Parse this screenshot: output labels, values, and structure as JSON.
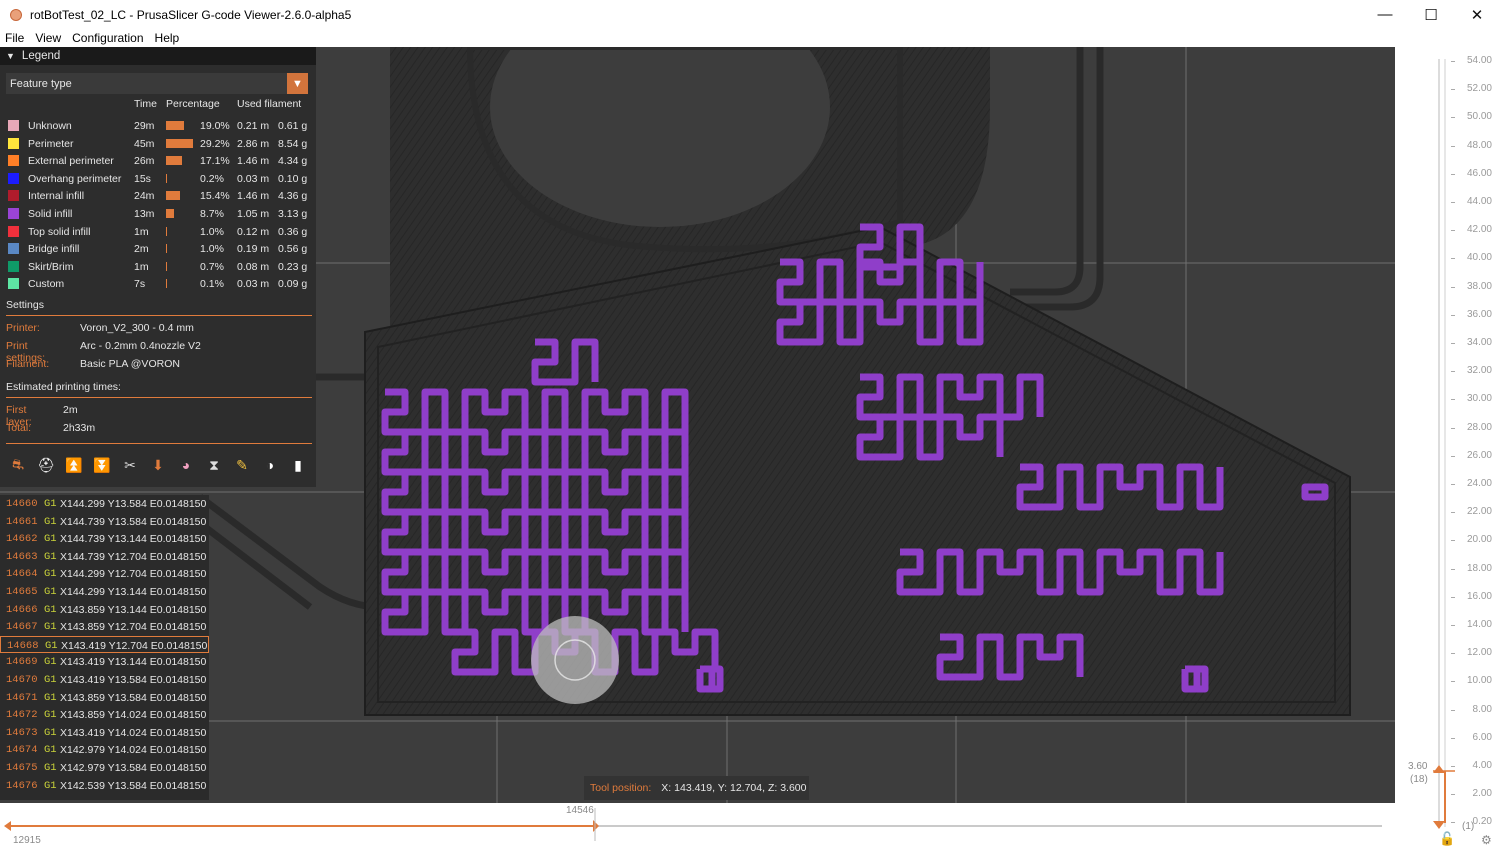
{
  "window": {
    "title": "rotBotTest_02_LC - PrusaSlicer G-code Viewer-2.6.0-alpha5",
    "controls": [
      "—",
      "☐",
      "✕"
    ]
  },
  "menu": [
    "File",
    "View",
    "Configuration",
    "Help"
  ],
  "legend": {
    "title": "Legend",
    "view_type": "Feature type",
    "columns": {
      "time": "Time",
      "percentage": "Percentage",
      "used_filament": "Used filament"
    },
    "items": [
      {
        "name": "Unknown",
        "time": "29m",
        "pct_text": "19.0%",
        "pct": 19.0,
        "length": "0.21 m",
        "weight": "0.61 g",
        "color": "#e8a8b8"
      },
      {
        "name": "Perimeter",
        "time": "45m",
        "pct_text": "29.2%",
        "pct": 29.2,
        "length": "2.86 m",
        "weight": "8.54 g",
        "color": "#ffe63c"
      },
      {
        "name": "External perimeter",
        "time": "26m",
        "pct_text": "17.1%",
        "pct": 17.1,
        "length": "1.46 m",
        "weight": "4.34 g",
        "color": "#ff7f27"
      },
      {
        "name": "Overhang perimeter",
        "time": "15s",
        "pct_text": "0.2%",
        "pct": 0.2,
        "length": "0.03 m",
        "weight": "0.10 g",
        "color": "#1c1cff"
      },
      {
        "name": "Internal infill",
        "time": "24m",
        "pct_text": "15.4%",
        "pct": 15.4,
        "length": "1.46 m",
        "weight": "4.36 g",
        "color": "#b01c2c"
      },
      {
        "name": "Solid infill",
        "time": "13m",
        "pct_text": "8.7%",
        "pct": 8.7,
        "length": "1.05 m",
        "weight": "3.13 g",
        "color": "#9a44d6"
      },
      {
        "name": "Top solid infill",
        "time": "1m",
        "pct_text": "1.0%",
        "pct": 1.0,
        "length": "0.12 m",
        "weight": "0.36 g",
        "color": "#f0303c"
      },
      {
        "name": "Bridge infill",
        "time": "2m",
        "pct_text": "1.0%",
        "pct": 1.0,
        "length": "0.19 m",
        "weight": "0.56 g",
        "color": "#5a88c4"
      },
      {
        "name": "Skirt/Brim",
        "time": "1m",
        "pct_text": "0.7%",
        "pct": 0.7,
        "length": "0.08 m",
        "weight": "0.23 g",
        "color": "#0f9a68"
      },
      {
        "name": "Custom",
        "time": "7s",
        "pct_text": "0.1%",
        "pct": 0.1,
        "length": "0.03 m",
        "weight": "0.09 g",
        "color": "#5ee6a4"
      }
    ],
    "settings": {
      "title": "Settings",
      "printer_label": "Printer:",
      "printer": "Voron_V2_300 - 0.4 mm",
      "print_label": "Print settings:",
      "print": "Arc - 0.2mm 0.4nozzle V2",
      "filament_label": "Filament:",
      "filament": "Basic PLA @VORON"
    },
    "times": {
      "title": "Estimated printing times:",
      "first_layer_label": "First layer:",
      "first_layer": "2m",
      "total_label": "Total:",
      "total": "2h33m"
    },
    "option_icons": [
      "travel-icon",
      "wipe-icon",
      "retraction-icon",
      "deretraction-icon",
      "seam-icon",
      "tool-change-icon",
      "color-change-icon",
      "pause-icon",
      "custom-gcode-icon",
      "center-of-gravity-icon",
      "shells-icon"
    ]
  },
  "gcode": [
    {
      "line": "14660",
      "cmd": "G1",
      "args": "X144.299 Y13.584 E0.0148150"
    },
    {
      "line": "14661",
      "cmd": "G1",
      "args": "X144.739 Y13.584 E0.0148150"
    },
    {
      "line": "14662",
      "cmd": "G1",
      "args": "X144.739 Y13.144 E0.0148150"
    },
    {
      "line": "14663",
      "cmd": "G1",
      "args": "X144.739 Y12.704 E0.0148150"
    },
    {
      "line": "14664",
      "cmd": "G1",
      "args": "X144.299 Y12.704 E0.0148150"
    },
    {
      "line": "14665",
      "cmd": "G1",
      "args": "X144.299 Y13.144 E0.0148150"
    },
    {
      "line": "14666",
      "cmd": "G1",
      "args": "X143.859 Y13.144 E0.0148150"
    },
    {
      "line": "14667",
      "cmd": "G1",
      "args": "X143.859 Y12.704 E0.0148150"
    },
    {
      "line": "14668",
      "cmd": "G1",
      "args": "X143.419 Y12.704 E0.0148150",
      "selected": true
    },
    {
      "line": "14669",
      "cmd": "G1",
      "args": "X143.419 Y13.144 E0.0148150"
    },
    {
      "line": "14670",
      "cmd": "G1",
      "args": "X143.419 Y13.584 E0.0148150"
    },
    {
      "line": "14671",
      "cmd": "G1",
      "args": "X143.859 Y13.584 E0.0148150"
    },
    {
      "line": "14672",
      "cmd": "G1",
      "args": "X143.859 Y14.024 E0.0148150"
    },
    {
      "line": "14673",
      "cmd": "G1",
      "args": "X143.419 Y14.024 E0.0148150"
    },
    {
      "line": "14674",
      "cmd": "G1",
      "args": "X142.979 Y14.024 E0.0148150"
    },
    {
      "line": "14675",
      "cmd": "G1",
      "args": "X142.979 Y13.584 E0.0148150"
    },
    {
      "line": "14676",
      "cmd": "G1",
      "args": "X142.539 Y13.584 E0.0148150"
    }
  ],
  "tool_position": {
    "label": "Tool position:",
    "value": "X: 143.419, Y: 12.704, Z: 3.600"
  },
  "hslider": {
    "current": "14546",
    "start": "12915",
    "position": 0.4
  },
  "vslider": {
    "ticks": [
      "54.00",
      "52.00",
      "50.00",
      "48.00",
      "46.00",
      "44.00",
      "42.00",
      "40.00",
      "38.00",
      "36.00",
      "34.00",
      "32.00",
      "30.00",
      "28.00",
      "26.00",
      "24.00",
      "22.00",
      "20.00",
      "18.00",
      "16.00",
      "14.00",
      "12.00",
      "10.00",
      "8.00",
      "6.00",
      "4.00",
      "2.00",
      "0.20"
    ],
    "current": "3.60",
    "current_layer": "(18)",
    "bottom_layer": "(1)"
  },
  "colors": {
    "accent": "#e07b3c",
    "infill": "#8f3ec9",
    "bed": "#3d3d3d",
    "model": "#2c2c2c"
  }
}
